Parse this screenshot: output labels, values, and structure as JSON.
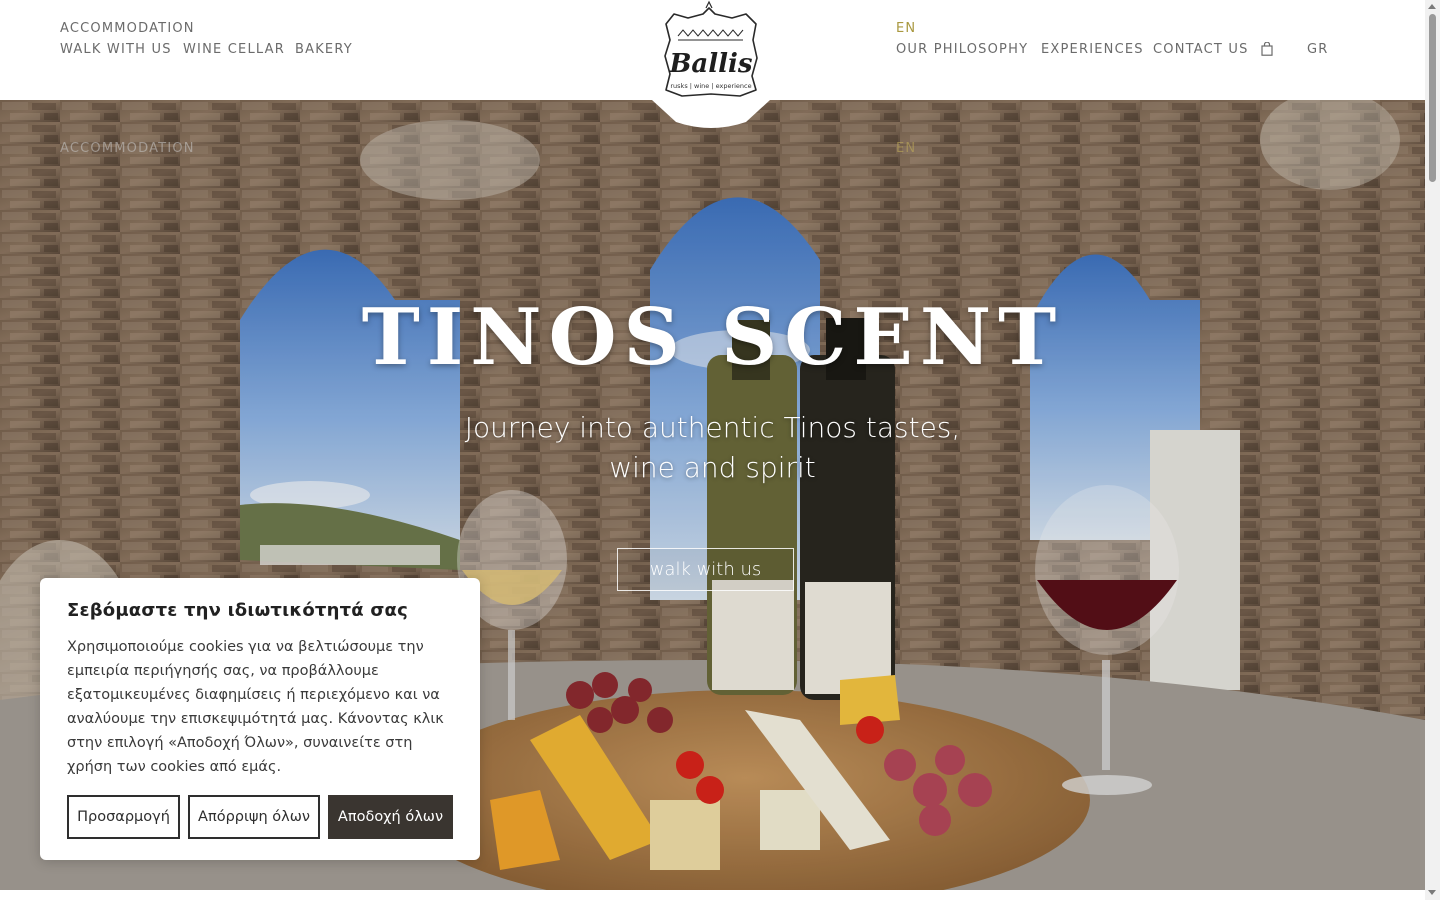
{
  "header": {
    "nav_left": {
      "accommodation": "ACCOMMODATION",
      "walk": "WALK WITH US",
      "wine": "WINE CELLAR",
      "bakery": "BAKERY"
    },
    "nav_right": {
      "lang_active": "EN",
      "philosophy": "OUR PHILOSOPHY",
      "experiences": "EXPERIENCES",
      "contact": "CONTACT US",
      "cart_icon": "shopping-bag-icon",
      "lang_alt": "GR"
    },
    "logo": {
      "name": "Ballis",
      "tagline": "rusks | wine | experience"
    }
  },
  "hero": {
    "ghost_left": "ACCOMMODATION",
    "ghost_right": "EN",
    "title": "TINOS SCENT",
    "subtitle_line1": "Journey into authentic Tinos tastes,",
    "subtitle_line2": "wine and spirit",
    "cta": "walk with us"
  },
  "cookie": {
    "title": "Σεβόμαστε την ιδιωτικότητά σας",
    "text": "Χρησιμοποιούμε cookies για να βελτιώσουμε την εμπειρία περιήγησής σας, να προβάλλουμε εξατομικευμένες διαφημίσεις ή περιεχόμενο και να αναλύουμε την επισκεψιμότητά μας. Κάνοντας κλικ στην επιλογή «Αποδοχή Όλων», συναινείτε στη χρήση των cookies από εμάς.",
    "customize": "Προσαρμογή",
    "reject": "Απόρριψη όλων",
    "accept": "Αποδοχή όλων"
  },
  "colors": {
    "gold_accent": "#a9983f",
    "nav_text": "#6b6b6b",
    "accept_button": "#3a3530"
  }
}
